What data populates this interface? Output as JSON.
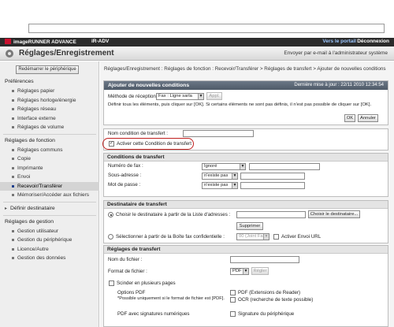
{
  "topbar": {
    "brand": "imageRUNNER ADVANCE",
    "device": "iR-ADV",
    "portal": "Vers le portail",
    "logout": "Déconnexion"
  },
  "titlebar": {
    "title": "Réglages/Enregistrement",
    "mail_link": "Envoyer par e-mail à l'administrateur système"
  },
  "sidebar": {
    "restart": "Redémarrer le périphérique",
    "groups": [
      {
        "label": "Préférences",
        "items": [
          "Réglages papier",
          "Réglages horloge/énergie",
          "Réglages réseau",
          "Interface externe",
          "Réglages de volume"
        ]
      },
      {
        "label": "Réglages de fonction",
        "items": [
          "Réglages communs",
          "Copie",
          "Imprimante",
          "Envoi",
          "Recevoir/Transférer",
          "Mémoriser/Accéder aux fichiers"
        ]
      },
      {
        "label": "Définir destinataire",
        "items": []
      },
      {
        "label": "Réglages de gestion",
        "items": [
          "Gestion utilisateur",
          "Gestion du périphérique",
          "Licence/Autre",
          "Gestion des données"
        ]
      }
    ]
  },
  "breadcrumb": "Réglages/Enregistrement : Réglages de fonction : Recevoir/Transférer > Réglages de transfert > Ajouter de nouvelles conditions",
  "panel": {
    "title": "Ajouter de nouvelles conditions",
    "updated": "Dernière mise à jour : 22/11 2010 12:34:54",
    "method_label": "Méthode de réception :",
    "method_value": "Fax : Ligne sarla",
    "apply_btn": "Appl.",
    "help_text": "Définir tous les éléments, puis cliquer sur [OK]. Si certains éléments ne sont pas définis, il n'est pas possible de cliquer sur [OK].",
    "ok": "OK",
    "cancel": "Annuler"
  },
  "condition": {
    "name_label": "Nom condition de transfert :",
    "enable_label": "Activer cette Condition de transfert"
  },
  "conditions": {
    "title": "Conditions de transfert",
    "fax_label": "Numéro de fax :",
    "fax_value": "Ignoré",
    "subaddr_label": "Sous-adresse :",
    "subaddr_value": "n'existe pas",
    "password_label": "Mot de passe :",
    "password_value": "n'existe pas"
  },
  "destination": {
    "title": "Destinataire de transfert",
    "from_list_label": "Choisir le destinataire à partir de la Liste d'adresses :",
    "choose_btn": "Choisir le destinataire...",
    "delete_btn": "Supprimer",
    "from_box_label": "Sélectionner à partir de la Boîte fax confidentielle :",
    "box_value": "00 (Joint Fax)",
    "url_label": "Activer Envoi URL"
  },
  "transfer": {
    "title": "Réglages de transfert",
    "filename_label": "Nom du fichier :",
    "format_label": "Format de fichier :",
    "format_value": "PDF",
    "format_btn": "Régler",
    "split_label": "Scinder en plusieurs pages",
    "pdf_options_label": "Options PDF",
    "pdf_options_note": "*Possible uniquement si le format de fichier est [PDF].",
    "pdf_reader": "PDF (Extensions de Reader)",
    "ocr": "OCR (recherche de texte possible)",
    "pdf_sig_label": "PDF avec signatures numériques",
    "device_sig": "Signature du périphérique"
  }
}
